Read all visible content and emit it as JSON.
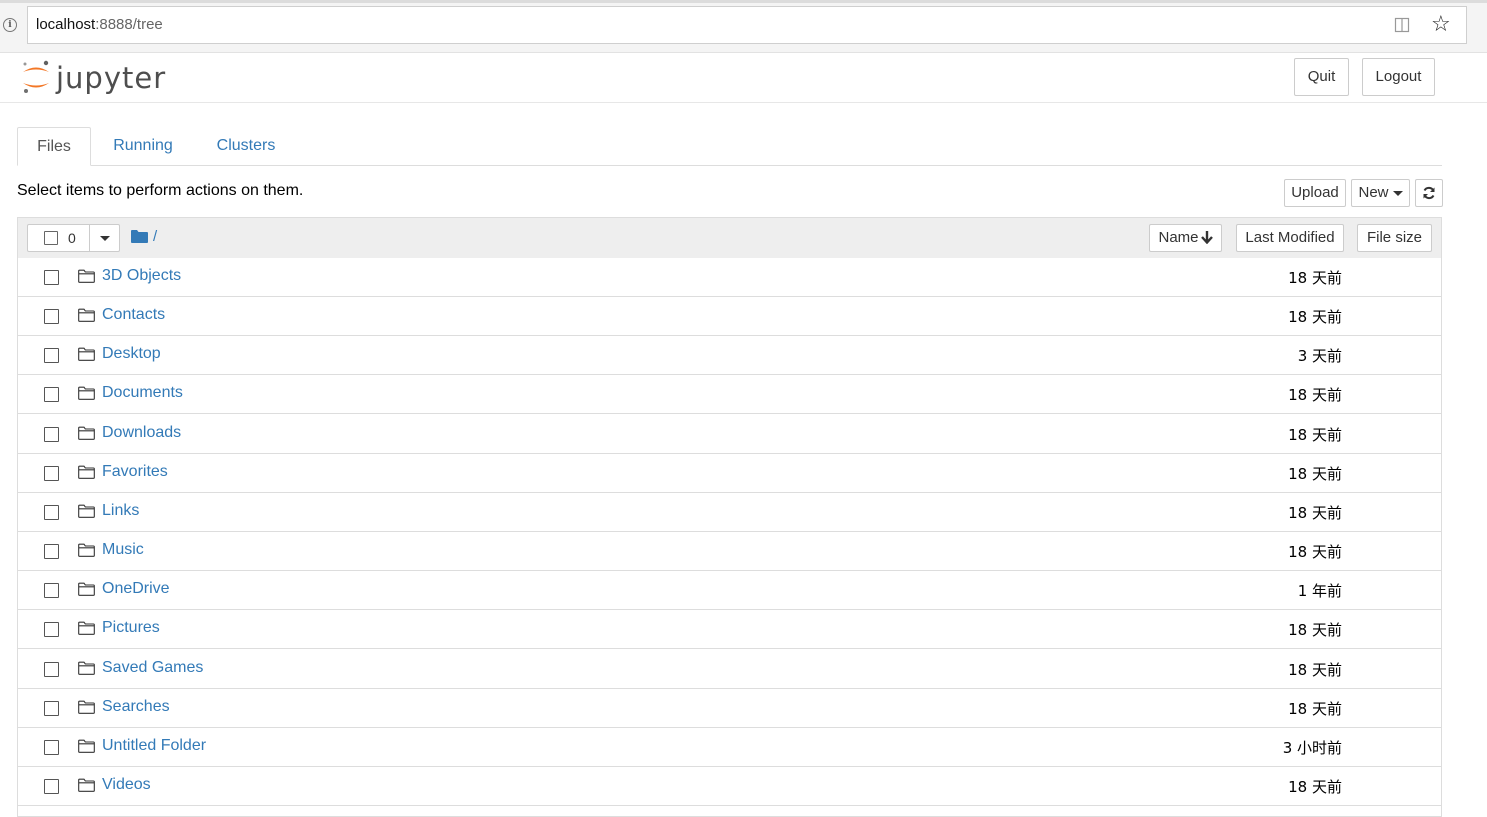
{
  "browser": {
    "url_host": "localhost",
    "url_rest": ":8888/tree",
    "info_icon": "i"
  },
  "header": {
    "logo_text": "jupyter",
    "quit_label": "Quit",
    "logout_label": "Logout"
  },
  "tabs": [
    {
      "label": "Files",
      "active": true
    },
    {
      "label": "Running",
      "active": false
    },
    {
      "label": "Clusters",
      "active": false
    }
  ],
  "toolbar": {
    "hint": "Select items to perform actions on them.",
    "upload_label": "Upload",
    "new_label": "New"
  },
  "list_header": {
    "selected_count": "0",
    "path": "/",
    "sort_name_label": "Name",
    "sort_modified_label": "Last Modified",
    "sort_size_label": "File size"
  },
  "files": [
    {
      "name": "3D Objects",
      "modified": "18 天前"
    },
    {
      "name": "Contacts",
      "modified": "18 天前"
    },
    {
      "name": "Desktop",
      "modified": "3 天前"
    },
    {
      "name": "Documents",
      "modified": "18 天前"
    },
    {
      "name": "Downloads",
      "modified": "18 天前"
    },
    {
      "name": "Favorites",
      "modified": "18 天前"
    },
    {
      "name": "Links",
      "modified": "18 天前"
    },
    {
      "name": "Music",
      "modified": "18 天前"
    },
    {
      "name": "OneDrive",
      "modified": "1 年前"
    },
    {
      "name": "Pictures",
      "modified": "18 天前"
    },
    {
      "name": "Saved Games",
      "modified": "18 天前"
    },
    {
      "name": "Searches",
      "modified": "18 天前"
    },
    {
      "name": "Untitled Folder",
      "modified": "3 小时前"
    },
    {
      "name": "Videos",
      "modified": "18 天前"
    }
  ],
  "colors": {
    "link": "#337ab7",
    "logo_orange": "#f37726",
    "logo_gray": "#616161"
  }
}
